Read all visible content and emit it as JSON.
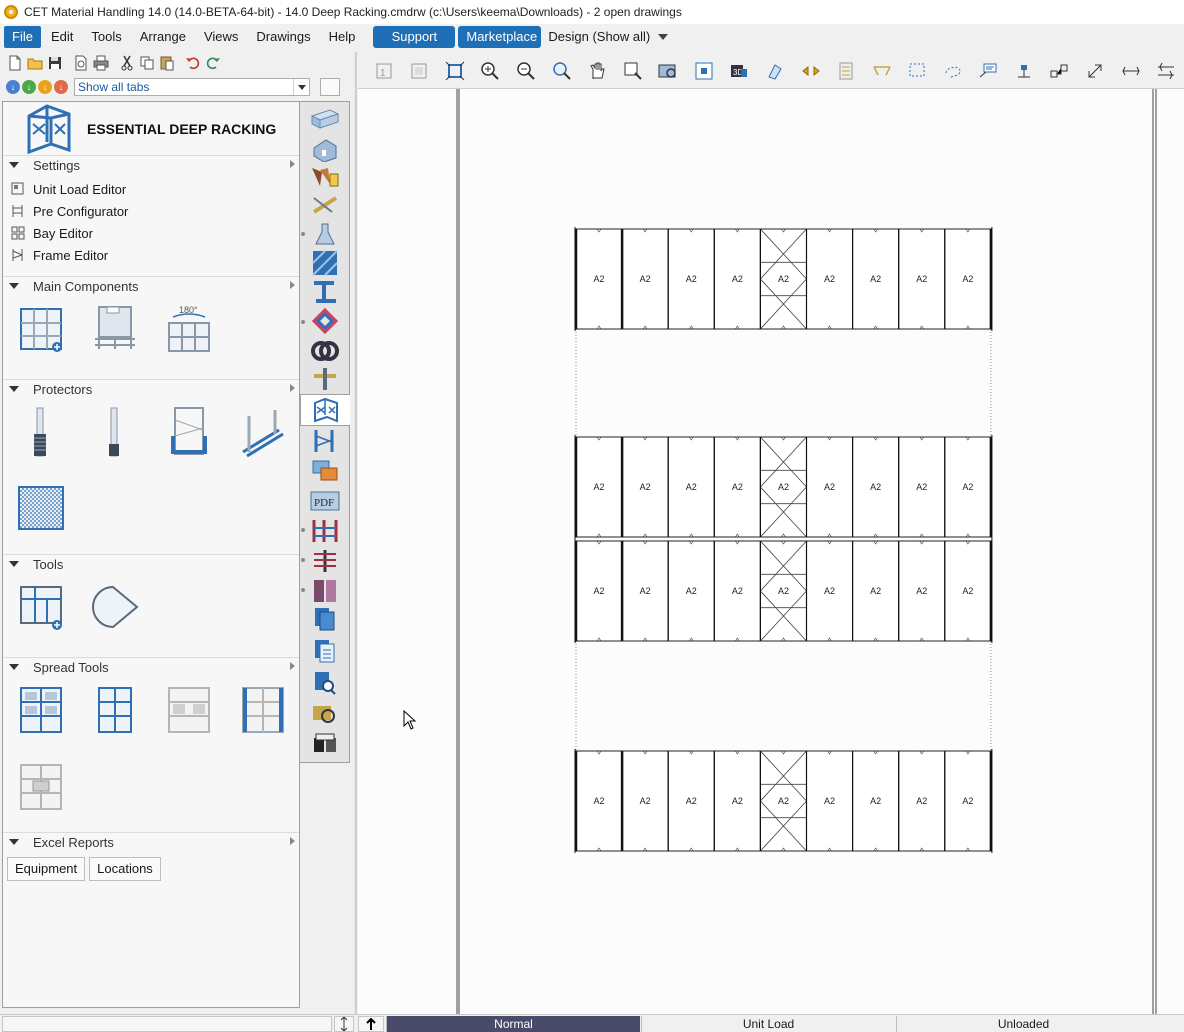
{
  "window": {
    "title": "CET Material Handling 14.0 (14.0-BETA-64-bit) - 14.0 Deep Racking.cmdrw (c:\\Users\\keema\\Downloads) - 2  open drawings"
  },
  "menu": {
    "items": [
      "File",
      "Edit",
      "Tools",
      "Arrange",
      "Views",
      "Drawings",
      "Help"
    ],
    "support": "Support",
    "marketplace": "Marketplace",
    "design_mode": "Design (Show all)"
  },
  "left_toolbar": {
    "tabs_filter": "Show all tabs"
  },
  "extension": {
    "title": "ESSENTIAL DEEP RACKING",
    "sections": {
      "settings": {
        "label": "Settings",
        "items": [
          "Unit Load Editor",
          "Pre Configurator",
          "Bay Editor",
          "Frame Editor"
        ]
      },
      "main_components": {
        "label": "Main Components",
        "badge_180": "180°"
      },
      "protectors": {
        "label": "Protectors"
      },
      "tools": {
        "label": "Tools"
      },
      "spread_tools": {
        "label": "Spread Tools"
      },
      "excel_reports": {
        "label": "Excel Reports",
        "buttons": [
          "Equipment",
          "Locations"
        ]
      }
    }
  },
  "drawing": {
    "bay_label": "A2",
    "rows": 4,
    "bays_per_row": 9
  },
  "status_bar": {
    "mode": "Normal",
    "field2": "Unit Load",
    "field3": "Unloaded"
  },
  "colors": {
    "accent": "#1e6fb5",
    "status_mode_bg": "#4a4a6a",
    "icon_blue": "#2f6fb3"
  }
}
